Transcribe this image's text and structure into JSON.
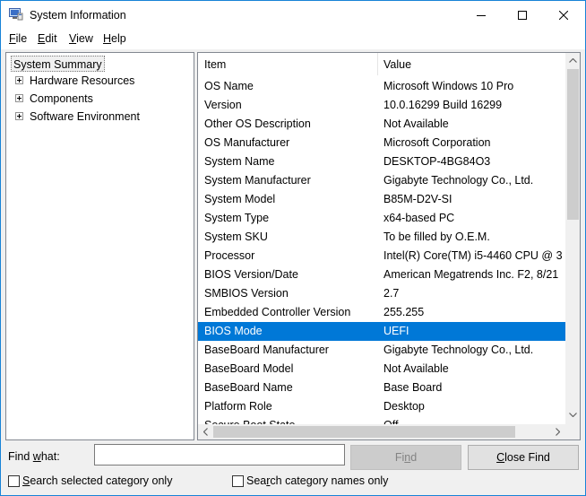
{
  "window": {
    "title": "System Information",
    "minimize": "minimize",
    "maximize": "maximize",
    "close": "close"
  },
  "menu": {
    "file": {
      "mnemonic": "F",
      "rest": "ile"
    },
    "edit": {
      "mnemonic": "E",
      "rest": "dit"
    },
    "view": {
      "mnemonic": "V",
      "rest": "iew"
    },
    "help": {
      "mnemonic": "H",
      "rest": "elp"
    }
  },
  "tree": {
    "root": "System Summary",
    "children": [
      "Hardware Resources",
      "Components",
      "Software Environment"
    ]
  },
  "list": {
    "headers": {
      "item": "Item",
      "value": "Value"
    },
    "selected_index": 13,
    "rows": [
      {
        "item": "OS Name",
        "value": "Microsoft Windows 10 Pro"
      },
      {
        "item": "Version",
        "value": "10.0.16299 Build 16299"
      },
      {
        "item": "Other OS Description",
        "value": "Not Available"
      },
      {
        "item": "OS Manufacturer",
        "value": "Microsoft Corporation"
      },
      {
        "item": "System Name",
        "value": "DESKTOP-4BG84O3"
      },
      {
        "item": "System Manufacturer",
        "value": "Gigabyte Technology Co., Ltd."
      },
      {
        "item": "System Model",
        "value": "B85M-D2V-SI"
      },
      {
        "item": "System Type",
        "value": "x64-based PC"
      },
      {
        "item": "System SKU",
        "value": "To be filled by O.E.M."
      },
      {
        "item": "Processor",
        "value": "Intel(R) Core(TM) i5-4460  CPU @ 3"
      },
      {
        "item": "BIOS Version/Date",
        "value": "American Megatrends Inc. F2, 8/21"
      },
      {
        "item": "SMBIOS Version",
        "value": "2.7"
      },
      {
        "item": "Embedded Controller Version",
        "value": "255.255"
      },
      {
        "item": "BIOS Mode",
        "value": "UEFI"
      },
      {
        "item": "BaseBoard Manufacturer",
        "value": "Gigabyte Technology Co., Ltd."
      },
      {
        "item": "BaseBoard Model",
        "value": "Not Available"
      },
      {
        "item": "BaseBoard Name",
        "value": "Base Board"
      },
      {
        "item": "Platform Role",
        "value": "Desktop"
      },
      {
        "item": "Secure Boot State",
        "value": "Off"
      }
    ]
  },
  "find": {
    "label_mnemonic": "w",
    "label_before": "Find ",
    "label_after": "hat:",
    "input_value": "",
    "find_button": {
      "before": "Fi",
      "mnemonic": "n",
      "after": "d"
    },
    "close_button": {
      "mnemonic": "C",
      "after": "lose Find"
    },
    "check_selected": {
      "mnemonic": "S",
      "after": "earch selected category only"
    },
    "check_names": {
      "before": "Sea",
      "mnemonic": "r",
      "after": "ch category names only"
    }
  },
  "colors": {
    "selection": "#0078d7",
    "window_border": "#1883d7"
  }
}
